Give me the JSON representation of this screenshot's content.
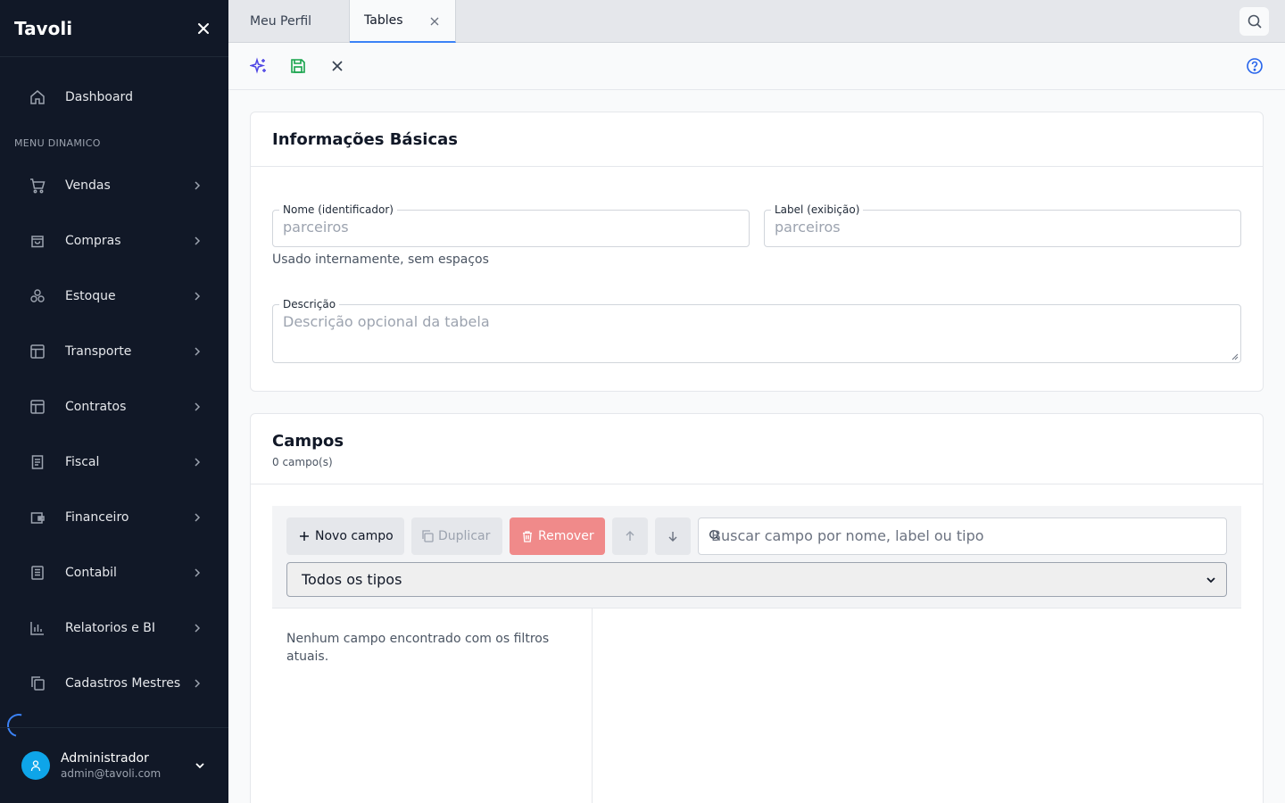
{
  "sidebar": {
    "brand": "Tavoli",
    "section_label": "MENU DINAMICO",
    "items": [
      {
        "label": "Dashboard",
        "icon": "home-icon"
      },
      {
        "label": "Vendas",
        "icon": "cart-icon"
      },
      {
        "label": "Compras",
        "icon": "bag-icon"
      },
      {
        "label": "Estoque",
        "icon": "boxes-icon"
      },
      {
        "label": "Transporte",
        "icon": "layout-icon"
      },
      {
        "label": "Contratos",
        "icon": "layout-icon"
      },
      {
        "label": "Fiscal",
        "icon": "receipt-icon"
      },
      {
        "label": "Financeiro",
        "icon": "wallet-icon"
      },
      {
        "label": "Contabil",
        "icon": "ledger-icon"
      },
      {
        "label": "Relatorios e BI",
        "icon": "bar-chart-icon"
      },
      {
        "label": "Cadastros Mestres",
        "icon": "copy-icon"
      }
    ],
    "user": {
      "name": "Administrador",
      "email": "admin@tavoli.com"
    }
  },
  "tabs": [
    {
      "label": "Meu Perfil",
      "active": false
    },
    {
      "label": "Tables",
      "active": true
    }
  ],
  "basic_info": {
    "title": "Informações Básicas",
    "name_label": "Nome (identificador)",
    "name_placeholder": "parceiros",
    "name_hint": "Usado internamente, sem espaços",
    "label_label": "Label (exibição)",
    "label_placeholder": "parceiros",
    "desc_label": "Descrição",
    "desc_placeholder": "Descrição opcional da tabela"
  },
  "fields_section": {
    "title": "Campos",
    "count": "0 campo(s)",
    "new_button": "Novo campo",
    "duplicate_button": "Duplicar",
    "remove_button": "Remover",
    "search_placeholder": "Buscar campo por nome, label ou tipo",
    "type_filter": "Todos os tipos",
    "empty_message": "Nenhum campo encontrado com os filtros atuais."
  },
  "colors": {
    "sidebar_bg": "#111827",
    "accent": "#3b82f6",
    "save_green": "#16a34a",
    "remove_red": "#f08a8a"
  }
}
